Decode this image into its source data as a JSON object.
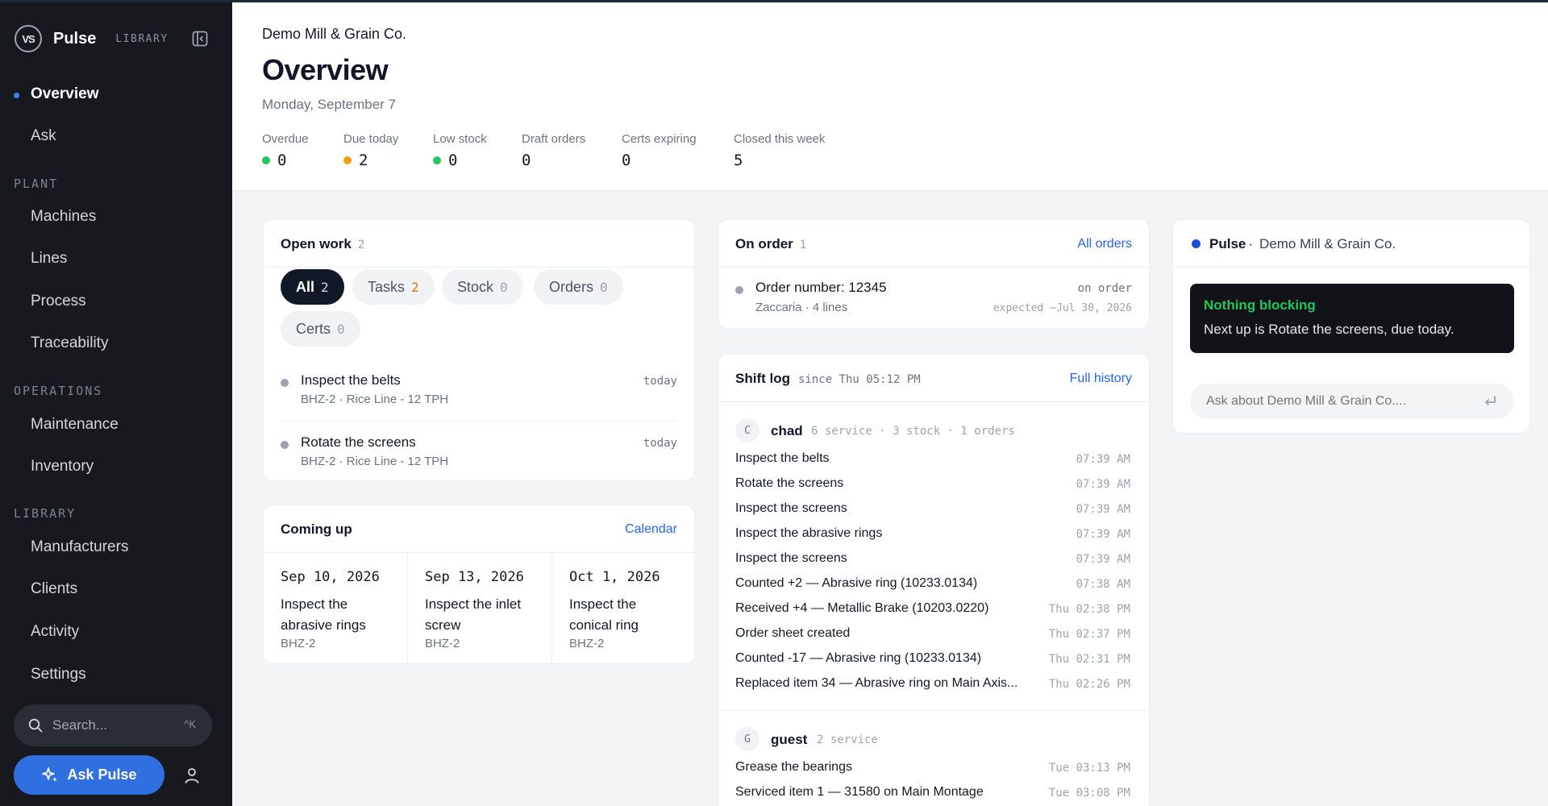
{
  "app": {
    "logo_text": "VS",
    "name": "Pulse",
    "section_tag": "LIBRARY"
  },
  "nav": {
    "top": [
      {
        "label": "Overview",
        "active": true
      },
      {
        "label": "Ask"
      }
    ],
    "sections": [
      {
        "title": "PLANT",
        "items": [
          "Machines",
          "Lines",
          "Process",
          "Traceability"
        ]
      },
      {
        "title": "OPERATIONS",
        "items": [
          "Maintenance",
          "Inventory"
        ]
      },
      {
        "title": "LIBRARY",
        "items": [
          "Manufacturers",
          "Clients",
          "Activity",
          "Settings"
        ]
      }
    ],
    "search_placeholder": "Search...",
    "search_shortcut": "^K",
    "ask_button": "Ask Pulse"
  },
  "header": {
    "company": "Demo Mill & Grain Co.",
    "title": "Overview",
    "date": "Monday, September 7",
    "stats": [
      {
        "label": "Overdue",
        "value": "0",
        "dot": "#22c55e"
      },
      {
        "label": "Due today",
        "value": "2",
        "dot": "#f59e0b"
      },
      {
        "label": "Low stock",
        "value": "0",
        "dot": "#22c55e"
      },
      {
        "label": "Draft orders",
        "value": "0"
      },
      {
        "label": "Certs expiring",
        "value": "0"
      },
      {
        "label": "Closed this week",
        "value": "5"
      }
    ]
  },
  "open_work": {
    "title": "Open work",
    "count": "2",
    "filters": [
      {
        "label": "All",
        "count": "2",
        "active": true
      },
      {
        "label": "Tasks",
        "count": "2",
        "highlight": "#e36b1a"
      },
      {
        "label": "Stock",
        "count": "0"
      },
      {
        "label": "Orders",
        "count": "0"
      },
      {
        "label": "Certs",
        "count": "0"
      }
    ],
    "tasks": [
      {
        "title": "Inspect the belts",
        "meta": "BHZ-2 · Rice Line - 12 TPH",
        "when": "today"
      },
      {
        "title": "Rotate the screens",
        "meta": "BHZ-2 · Rice Line - 12 TPH",
        "when": "today"
      }
    ]
  },
  "coming_up": {
    "title": "Coming up",
    "link": "Calendar",
    "items": [
      {
        "date": "Sep 10, 2026",
        "title": "Inspect the abrasive rings",
        "line": "BHZ-2"
      },
      {
        "date": "Sep 13, 2026",
        "title": "Inspect the inlet screw",
        "line": "BHZ-2"
      },
      {
        "date": "Oct 1, 2026",
        "title": "Inspect the conical ring",
        "line": "BHZ-2"
      }
    ]
  },
  "on_order": {
    "title": "On order",
    "count": "1",
    "link": "All orders",
    "order": {
      "title": "Order number: 12345",
      "meta": "Zaccaria · 4 lines",
      "status": "on order",
      "expected": "expected ~Jul 30, 2026"
    }
  },
  "shift_log": {
    "title": "Shift log",
    "since": "since Thu 05:12 PM",
    "link": "Full history",
    "users": [
      {
        "initial": "C",
        "name": "chad",
        "meta": "6 service · 3 stock · 1 orders",
        "entries": [
          {
            "text": "Inspect the belts",
            "time": "07:39 AM"
          },
          {
            "text": "Rotate the screens",
            "time": "07:39 AM"
          },
          {
            "text": "Inspect the screens",
            "time": "07:39 AM"
          },
          {
            "text": "Inspect the abrasive rings",
            "time": "07:39 AM"
          },
          {
            "text": "Inspect the screens",
            "time": "07:39 AM"
          },
          {
            "text": "Counted +2 — Abrasive ring (10233.0134)",
            "time": "07:38 AM"
          },
          {
            "text": "Received +4 — Metallic Brake (10203.0220)",
            "time": "Thu 02:38 PM"
          },
          {
            "text": "Order sheet created",
            "time": "Thu 02:37 PM"
          },
          {
            "text": "Counted -17 — Abrasive ring (10233.0134)",
            "time": "Thu 02:31 PM"
          },
          {
            "text": "Replaced item 34 — Abrasive ring on Main Axis...",
            "time": "Thu 02:26 PM"
          }
        ]
      },
      {
        "initial": "G",
        "name": "guest",
        "meta": "2 service",
        "entries": [
          {
            "text": "Grease the bearings",
            "time": "Tue 03:13 PM"
          },
          {
            "text": "Serviced item 1 — 31580 on Main Montage",
            "time": "Tue 03:08 PM"
          }
        ]
      }
    ]
  },
  "pulse": {
    "name": "Pulse",
    "separator": "·",
    "company": "Demo Mill & Grain Co.",
    "status_title": "Nothing blocking",
    "status_text": "Next up is Rotate the screens, due today.",
    "ask_placeholder": "Ask about Demo Mill & Grain Co...."
  },
  "colors": {
    "accent": "#2f6fe0",
    "sidebar_bg": "#17191e",
    "ok": "#22c55e",
    "warn": "#f59e0b"
  }
}
